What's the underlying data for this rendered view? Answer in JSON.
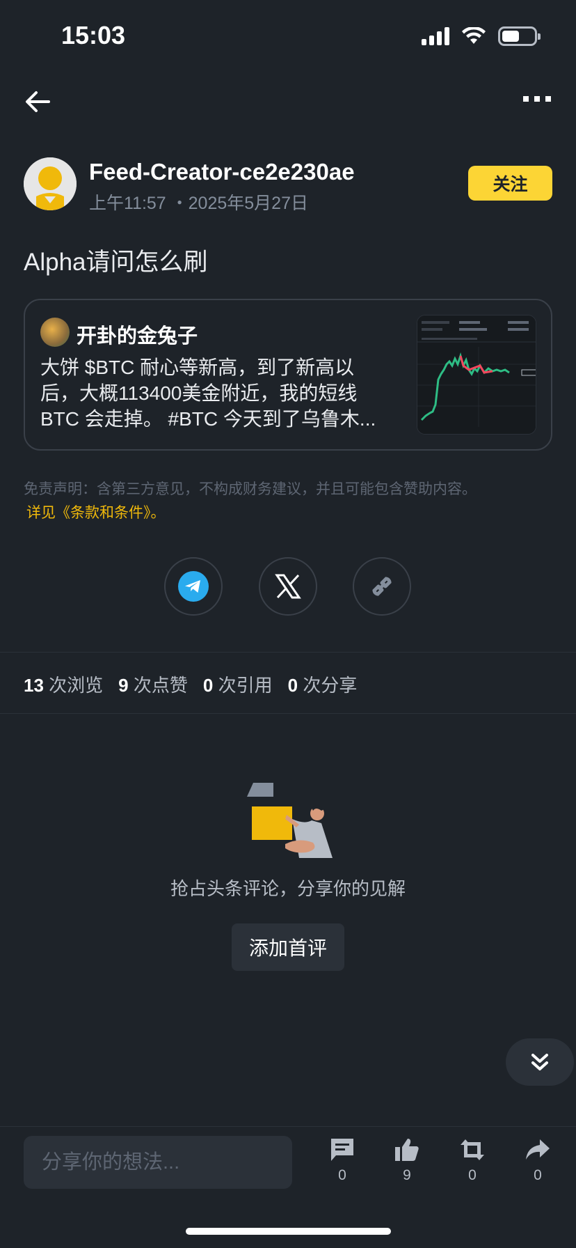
{
  "status_bar": {
    "time": "15:03"
  },
  "author": {
    "name": "Feed-Creator-ce2e230ae",
    "time": "上午11:57 ・2025年5月27日",
    "follow_label": "关注"
  },
  "post": {
    "body": "Alpha请问怎么刷"
  },
  "quoted": {
    "author": "开卦的金兔子",
    "text": "大饼 $BTC 耐心等新高，到了新高以后，大概113400美金附近，我的短线BTC 会走掉。 #BTC 今天到了乌鲁木..."
  },
  "disclaimer": {
    "text": "免责声明：含第三方意见，不构成财务建议，并且可能包含赞助内容。",
    "link": "详见《条款和条件》。"
  },
  "share": {
    "icons": [
      "telegram-icon",
      "x-icon",
      "link-icon"
    ]
  },
  "stats": {
    "views": "13",
    "views_label": "次浏览",
    "likes": "9",
    "likes_label": "次点赞",
    "quotes": "0",
    "quotes_label": "次引用",
    "shares": "0",
    "shares_label": "次分享"
  },
  "empty": {
    "text": "抢占头条评论，分享你的见解",
    "button": "添加首评"
  },
  "bottom_bar": {
    "placeholder": "分享你的想法...",
    "comments": "0",
    "likes": "9",
    "reposts": "0",
    "shares": "0"
  },
  "colors": {
    "background": "#1e2329",
    "accent": "#fcd535",
    "link": "#f0b90b",
    "telegram": "#2aabee"
  }
}
